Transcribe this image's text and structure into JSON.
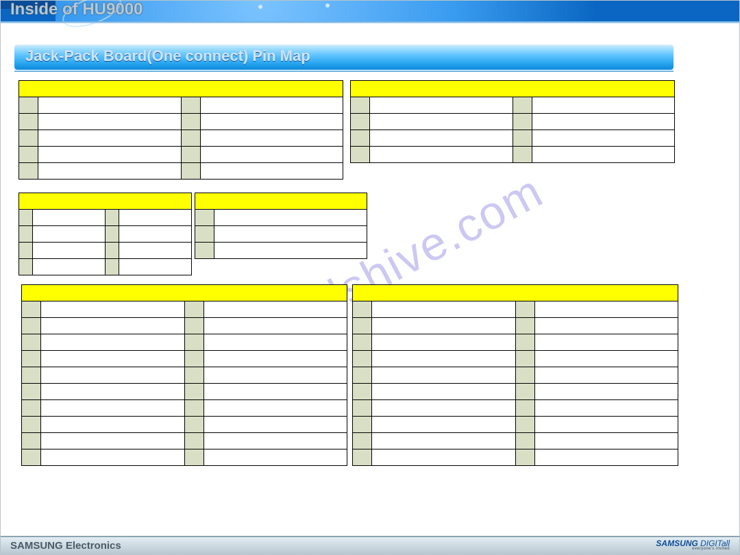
{
  "header": {
    "title": "Inside of HU9000"
  },
  "section": {
    "title": "Jack-Pack Board(One connect) Pin Map"
  },
  "watermark": "manualshive.com",
  "footer": {
    "left": "SAMSUNG Electronics",
    "brand_main": "SAMSUNG",
    "brand_tail": "DIGITall",
    "brand_sub": "everyone's invited"
  },
  "tables": {
    "t1": {
      "header": "",
      "rows": 5,
      "layout": [
        "idx",
        "",
        "idx",
        ""
      ]
    },
    "t2": {
      "header": "",
      "rows": 4,
      "layout": [
        "idx",
        "",
        "idx",
        ""
      ]
    },
    "t3": {
      "header": "",
      "rows": 4,
      "layout": [
        "idx",
        "",
        "idx",
        ""
      ]
    },
    "t4": {
      "header": "",
      "rows": 3,
      "layout": [
        "idx",
        ""
      ]
    },
    "t5": {
      "header": "",
      "rows": 10,
      "layout": [
        "idx",
        "",
        "idx",
        ""
      ]
    },
    "t6": {
      "header": "",
      "rows": 10,
      "layout": [
        "idx",
        "",
        "idx",
        ""
      ]
    }
  }
}
